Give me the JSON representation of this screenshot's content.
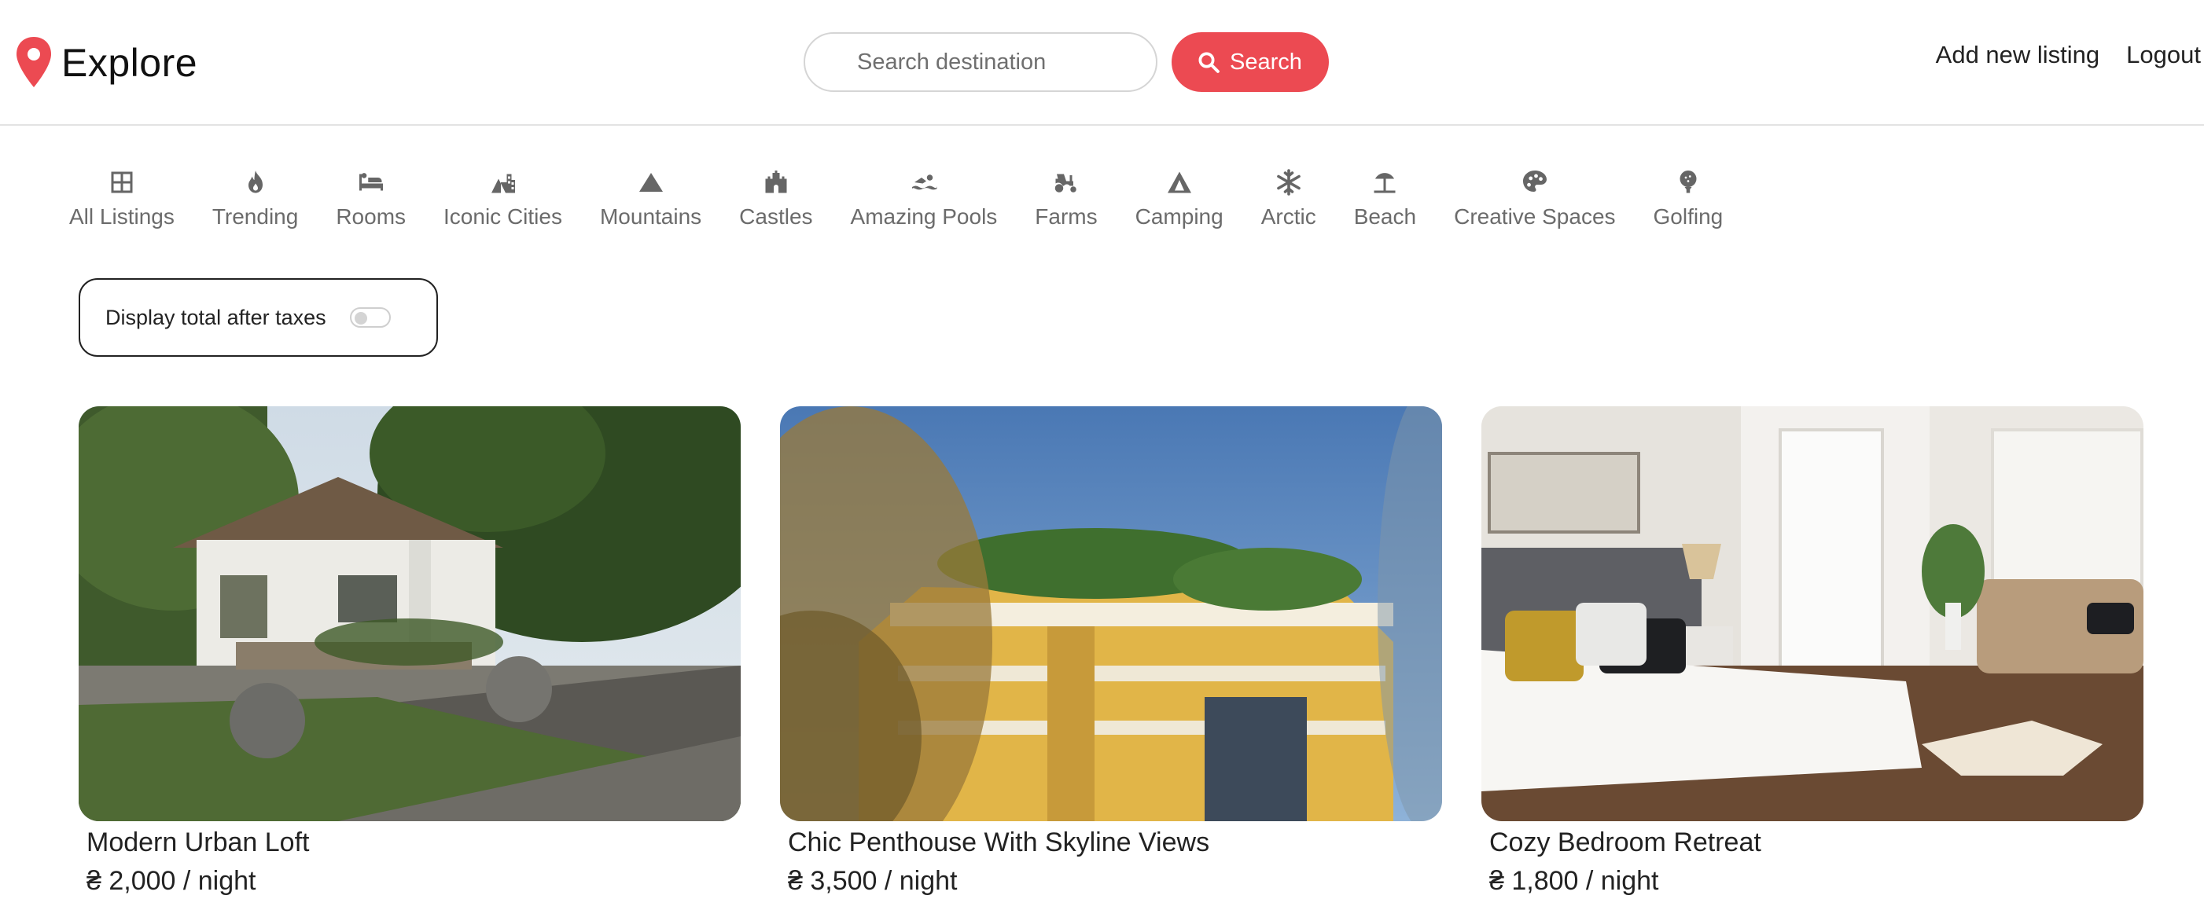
{
  "brand": {
    "name": "Explore",
    "accent": "#ec4a52"
  },
  "search": {
    "placeholder": "Search destination",
    "button_label": "Search"
  },
  "nav": {
    "add_listing": "Add new listing",
    "logout": "Logout"
  },
  "filters": [
    {
      "label": "All Listings",
      "icon": "grid-icon"
    },
    {
      "label": "Trending",
      "icon": "fire-icon"
    },
    {
      "label": "Rooms",
      "icon": "bed-icon"
    },
    {
      "label": "Iconic Cities",
      "icon": "city-icon"
    },
    {
      "label": "Mountains",
      "icon": "mountain-icon"
    },
    {
      "label": "Castles",
      "icon": "castle-icon"
    },
    {
      "label": "Amazing Pools",
      "icon": "swimmer-icon"
    },
    {
      "label": "Farms",
      "icon": "tractor-icon"
    },
    {
      "label": "Camping",
      "icon": "tent-icon"
    },
    {
      "label": "Arctic",
      "icon": "snowflake-icon"
    },
    {
      "label": "Beach",
      "icon": "umbrella-beach-icon"
    },
    {
      "label": "Creative Spaces",
      "icon": "palette-icon"
    },
    {
      "label": "Golfing",
      "icon": "golf-ball-icon"
    }
  ],
  "tax_toggle": {
    "label": "Display total after taxes",
    "enabled": false
  },
  "listings": [
    {
      "title": "Modern Urban Loft",
      "price": "₴ 2,000 / night"
    },
    {
      "title": "Chic Penthouse With Skyline Views",
      "price": "₴ 3,500 / night"
    },
    {
      "title": "Cozy Bedroom Retreat",
      "price": "₴ 1,800 / night"
    }
  ]
}
